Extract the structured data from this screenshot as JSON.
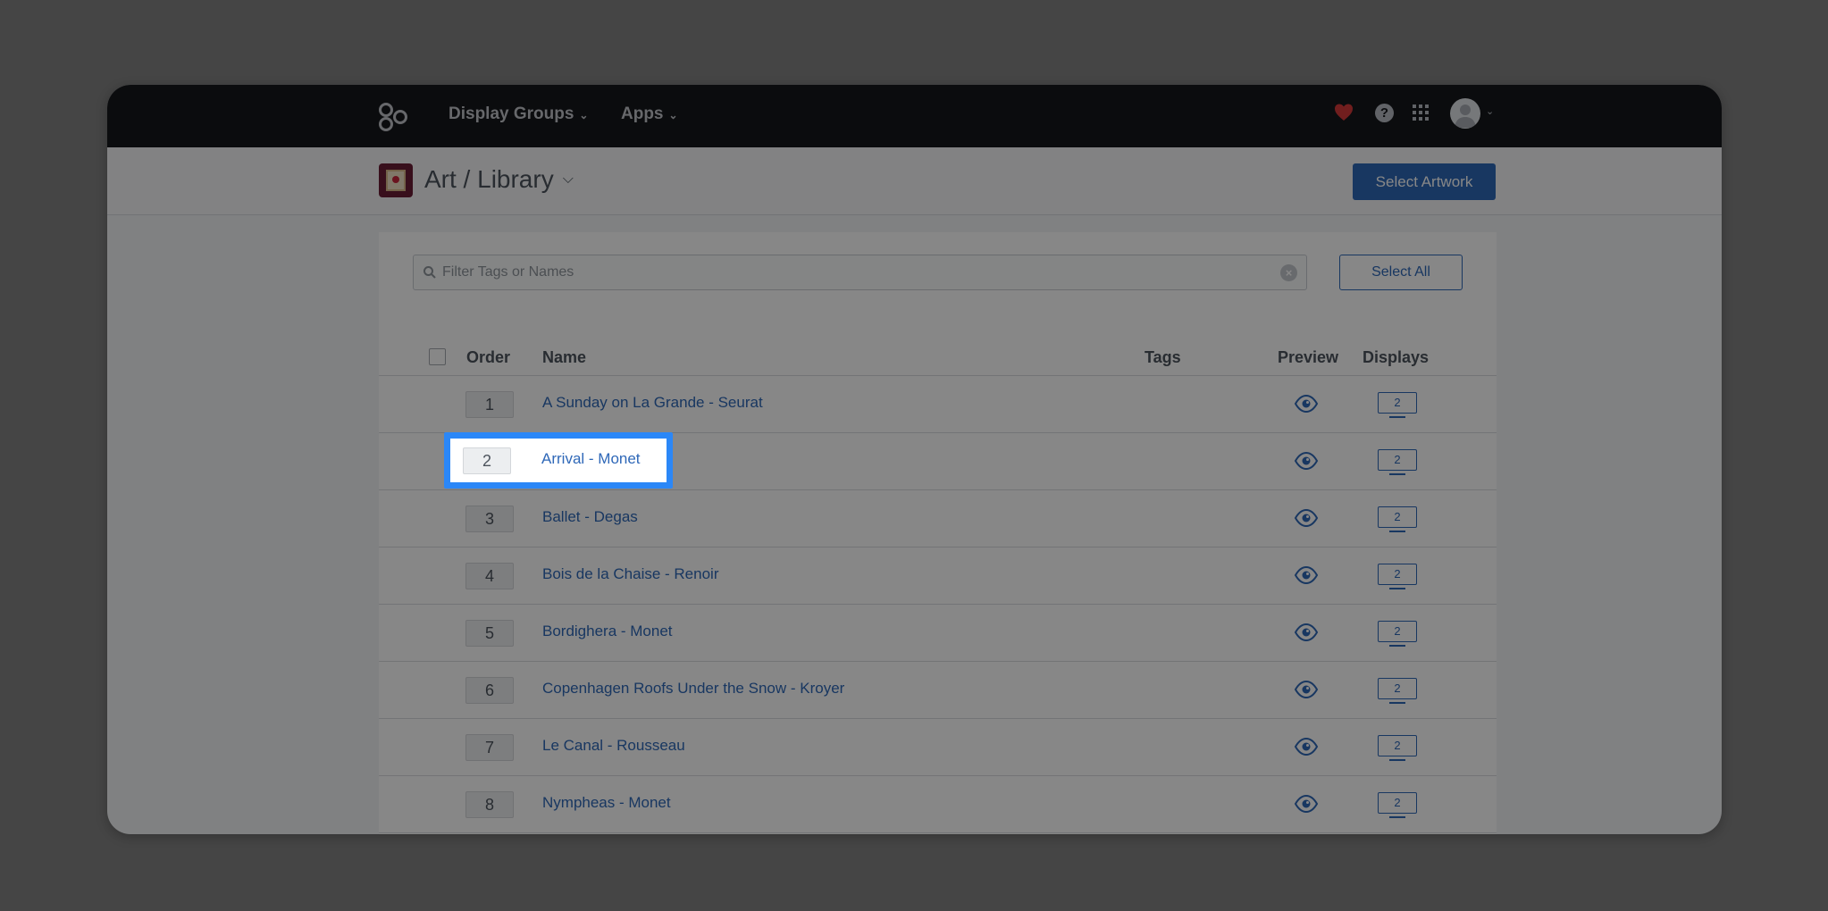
{
  "nav": {
    "items": [
      {
        "label": "Display Groups"
      },
      {
        "label": "Apps"
      }
    ],
    "help_label": "?"
  },
  "subheader": {
    "title": "Art / Library",
    "select_artwork": "Select Artwork"
  },
  "filter": {
    "placeholder": "Filter Tags or Names",
    "clear_label": "×",
    "select_all": "Select All"
  },
  "table": {
    "columns": {
      "order": "Order",
      "name": "Name",
      "tags": "Tags",
      "preview": "Preview",
      "displays": "Displays"
    },
    "rows": [
      {
        "order": "1",
        "name": "A Sunday on La Grande - Seurat",
        "displays": "2"
      },
      {
        "order": "2",
        "name": "Arrival - Monet",
        "displays": "2"
      },
      {
        "order": "3",
        "name": "Ballet - Degas",
        "displays": "2"
      },
      {
        "order": "4",
        "name": "Bois de la Chaise - Renoir",
        "displays": "2"
      },
      {
        "order": "5",
        "name": "Bordighera - Monet",
        "displays": "2"
      },
      {
        "order": "6",
        "name": "Copenhagen Roofs Under the Snow - Kroyer",
        "displays": "2"
      },
      {
        "order": "7",
        "name": "Le Canal - Rousseau",
        "displays": "2"
      },
      {
        "order": "8",
        "name": "Nympheas - Monet",
        "displays": "2"
      }
    ]
  },
  "colors": {
    "nav_bg": "#15171b",
    "accent": "#2f68b8",
    "highlight": "#2b87f7",
    "heart": "#d63a3a"
  }
}
